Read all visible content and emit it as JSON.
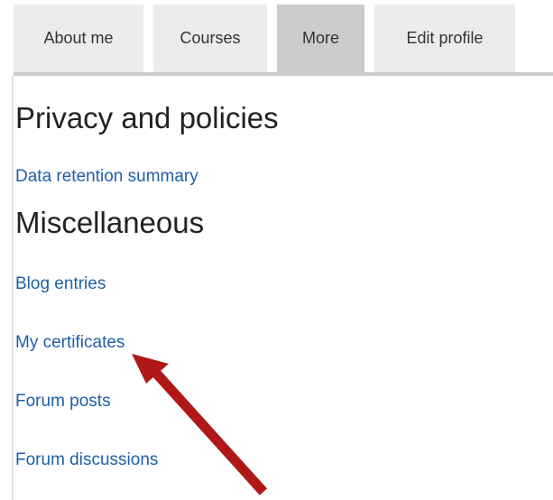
{
  "tabs": [
    {
      "label": "About me",
      "active": false
    },
    {
      "label": "Courses",
      "active": false
    },
    {
      "label": "More",
      "active": true
    },
    {
      "label": "Edit profile",
      "active": false
    }
  ],
  "sections": {
    "privacy": {
      "heading": "Privacy and policies",
      "links": [
        "Data retention summary"
      ]
    },
    "misc": {
      "heading": "Miscellaneous",
      "links": [
        "Blog entries",
        "My certificates",
        "Forum posts",
        "Forum discussions"
      ]
    }
  },
  "annotation": {
    "type": "arrow",
    "color": "#b01818",
    "points_to": "My certificates"
  },
  "colors": {
    "link": "#1f5fa6",
    "tab_bg": "#ececec",
    "tab_active_bg": "#cccccc"
  }
}
